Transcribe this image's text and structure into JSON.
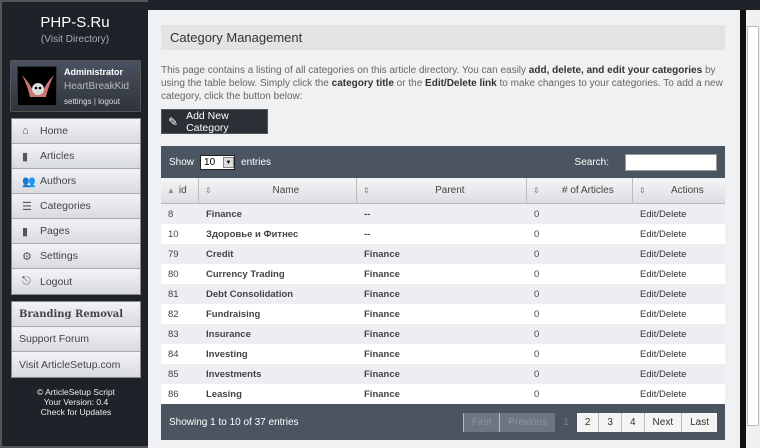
{
  "sidebar": {
    "brand": "PHP-S.Ru",
    "visit": "(Visit Directory)",
    "user": {
      "role": "Administrator",
      "name": "HeartBreakKid",
      "settings": "settings",
      "sep": "|",
      "logout": "logout"
    },
    "nav": [
      {
        "label": "Home",
        "icon": "home-icon"
      },
      {
        "label": "Articles",
        "icon": "articles-icon"
      },
      {
        "label": "Authors",
        "icon": "authors-icon"
      },
      {
        "label": "Categories",
        "icon": "categories-icon"
      },
      {
        "label": "Pages",
        "icon": "pages-icon"
      },
      {
        "label": "Settings",
        "icon": "gear-icon"
      },
      {
        "label": "Logout",
        "icon": "logout-icon"
      }
    ],
    "extra": [
      "Branding Removal",
      "Support Forum",
      "Visit ArticleSetup.com"
    ],
    "footer": [
      "© ArticleSetup Script",
      "Your Version: 0.4",
      "Check for Updates"
    ]
  },
  "main": {
    "title": "Category Management",
    "desc": {
      "p1": "This page contains a listing of all categories on this article directory. You can easily ",
      "b1": "add, delete, and edit your categories",
      "p2": " by using the table below. Simply click the ",
      "b2": "category title",
      "p3": " or the ",
      "b3": "Edit/Delete link",
      "p4": " to make changes to your categories. To add a new category, click the button below:"
    },
    "add_button": "Add New Category",
    "table": {
      "show": "Show",
      "page_size": "10",
      "entries": "entries",
      "search_label": "Search:",
      "search_value": "",
      "columns": [
        "id",
        "Name",
        "Parent",
        "# of Articles",
        "Actions"
      ],
      "rows": [
        [
          "8",
          "Finance",
          "--",
          "0",
          "Edit/Delete"
        ],
        [
          "10",
          "Здоровье и Фитнес",
          "--",
          "0",
          "Edit/Delete"
        ],
        [
          "79",
          "Credit",
          "Finance",
          "0",
          "Edit/Delete"
        ],
        [
          "80",
          "Currency Trading",
          "Finance",
          "0",
          "Edit/Delete"
        ],
        [
          "81",
          "Debt Consolidation",
          "Finance",
          "0",
          "Edit/Delete"
        ],
        [
          "82",
          "Fundraising",
          "Finance",
          "0",
          "Edit/Delete"
        ],
        [
          "83",
          "Insurance",
          "Finance",
          "0",
          "Edit/Delete"
        ],
        [
          "84",
          "Investing",
          "Finance",
          "0",
          "Edit/Delete"
        ],
        [
          "85",
          "Investments",
          "Finance",
          "0",
          "Edit/Delete"
        ],
        [
          "86",
          "Leasing",
          "Finance",
          "0",
          "Edit/Delete"
        ]
      ],
      "info": "Showing 1 to 10 of 37 entries",
      "pager": [
        "First",
        "Previous",
        "1",
        "2",
        "3",
        "4",
        "Next",
        "Last"
      ]
    }
  }
}
